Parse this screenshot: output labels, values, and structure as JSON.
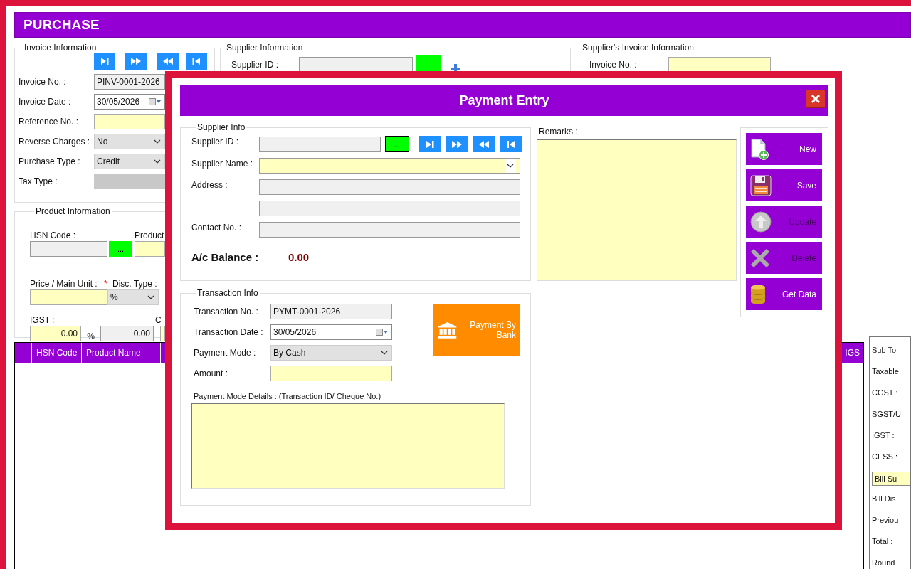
{
  "window": {
    "title": "PURCHASE"
  },
  "invoice_information": {
    "title": "Invoice Information",
    "fields": [
      {
        "label": "Invoice No. :",
        "value": "PINV-0001-2026",
        "kind": "readonly"
      },
      {
        "label": "Invoice Date :",
        "value": "30/05/2026",
        "kind": "date"
      },
      {
        "label": "Reference No. :",
        "kind": "entry"
      },
      {
        "label": "Reverse Charges :",
        "value": "No",
        "kind": "combo"
      },
      {
        "label": "Purchase Type :",
        "value": "Credit",
        "kind": "combo"
      },
      {
        "label": "Tax Type :",
        "kind": "disabled"
      }
    ]
  },
  "supplier_information": {
    "title": "Supplier Information",
    "id_label": "Supplier ID :"
  },
  "suppliers_invoice_information": {
    "title": "Supplier's Invoice Information",
    "invoice_label": "Invoice No. :"
  },
  "product_information": {
    "title": "Product Information",
    "hsn_label": "HSN Code :",
    "lookup_button": "...",
    "product_label": "Product",
    "price_label": "Price / Main Unit :",
    "required_mark": "*",
    "disc_label": "Disc. Type :",
    "disc_value": "%",
    "igst_label": "IGST :",
    "igst_value": "0.00",
    "percent": "%",
    "igst_amount": "0.00",
    "cut_label": "C"
  },
  "table": {
    "columns": [
      {
        "label": "HSN Code"
      },
      {
        "label": "Product Name"
      },
      {
        "label": "IGS"
      }
    ]
  },
  "totals": {
    "labels": [
      {
        "text": "Sub To",
        "kind": "label"
      },
      {
        "text": "Taxable",
        "kind": "label"
      },
      {
        "text": "CGST :",
        "kind": "label"
      },
      {
        "text": "SGST/U",
        "kind": "label"
      },
      {
        "text": "IGST :",
        "kind": "label"
      },
      {
        "text": "CESS :",
        "kind": "label"
      },
      {
        "text": "Bill Su",
        "kind": "box"
      },
      {
        "text": "Bill Dis",
        "kind": "label"
      },
      {
        "text": "Previou",
        "kind": "label"
      },
      {
        "text": "Total :",
        "kind": "label"
      },
      {
        "text": "Round",
        "kind": "label"
      }
    ]
  },
  "payment_entry": {
    "title": "Payment Entry",
    "supplier_info": {
      "title": "Supplier Info",
      "lookup_button": "...",
      "fields": [
        {
          "label": "Supplier ID :",
          "kind": "readonly"
        },
        {
          "label": "Supplier Name :",
          "kind": "entrycombo"
        },
        {
          "label": "Address :",
          "kind": "readonly"
        },
        {
          "kind": "readonly"
        },
        {
          "label": "Contact No. :",
          "kind": "readonly"
        }
      ],
      "balance_label": "A/c Balance :",
      "balance_value": "0.00"
    },
    "remarks": {
      "label": "Remarks :"
    },
    "actions": [
      {
        "label": "New",
        "kind": "new",
        "disabled": false
      },
      {
        "label": "Save",
        "kind": "save",
        "disabled": false
      },
      {
        "label": "Update",
        "kind": "update",
        "disabled": true
      },
      {
        "label": "Delete",
        "kind": "delete",
        "disabled": true
      },
      {
        "label": "Get Data",
        "kind": "getdata",
        "disabled": false
      }
    ],
    "transaction_info": {
      "title": "Transaction Info",
      "fields": [
        {
          "label": "Transaction No. :",
          "value": "PYMT-0001-2026",
          "kind": "readonly"
        },
        {
          "label": "Transaction Date :",
          "value": "30/05/2026",
          "kind": "date"
        },
        {
          "label": "Payment Mode :",
          "value": "By Cash",
          "kind": "combo"
        },
        {
          "label": "Amount :",
          "kind": "entry"
        }
      ],
      "bank_button": "Payment By Bank",
      "details_label": "Payment Mode Details : (Transaction ID/ Cheque No.)"
    }
  }
}
